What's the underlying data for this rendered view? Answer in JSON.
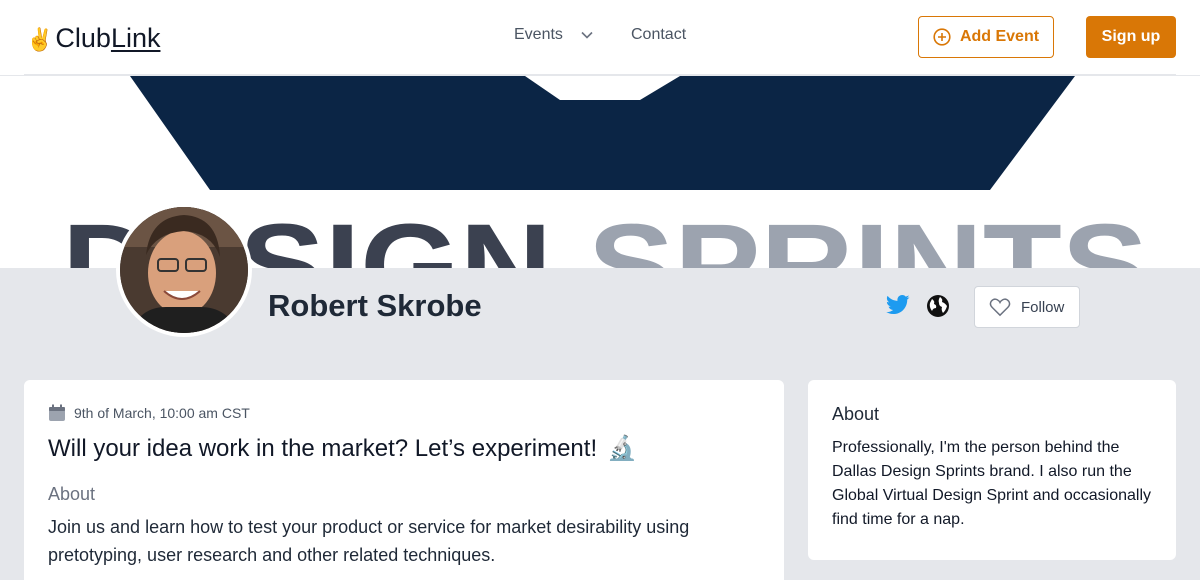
{
  "brand": {
    "emoji": "✌",
    "part1": "Club",
    "part2": "Link"
  },
  "nav": {
    "events_label": "Events",
    "contact_label": "Contact"
  },
  "header": {
    "add_event_label": "Add Event",
    "signup_label": "Sign up"
  },
  "banner": {
    "text_left": "DESIGN",
    "text_right": "SPRINTS"
  },
  "profile": {
    "name": "Robert Skrobe",
    "follow_label": "Follow"
  },
  "event": {
    "date": "9th of March, 10:00 am CST",
    "title": "Will your idea work in the market? Let’s experiment!",
    "title_emoji": "🔬",
    "about_heading": "About",
    "description": "Join us and learn how to test your product or service for market desirability using pretotyping, user research and other related techniques."
  },
  "about": {
    "heading": "About",
    "text": "Professionally, I'm the person behind the Dallas Design Sprints brand. I also run the Global Virtual Design Sprint and occasionally find time for a nap."
  },
  "colors": {
    "accent": "#d97706",
    "navy": "#0b2545",
    "twitter": "#1d9bf0"
  }
}
